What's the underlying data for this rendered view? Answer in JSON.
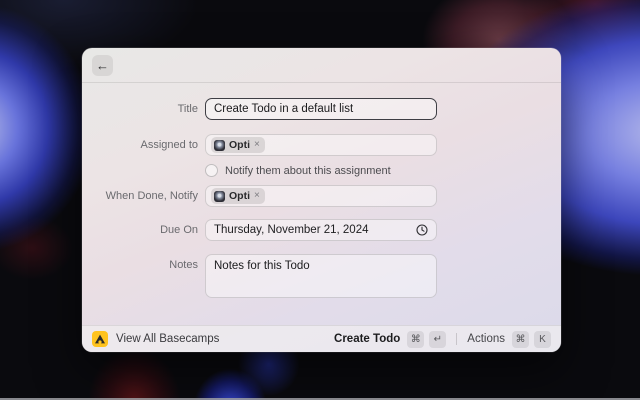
{
  "window": {
    "back_glyph": "←"
  },
  "form": {
    "title": {
      "label": "Title",
      "value": "Create Todo in a default list"
    },
    "assigned_to": {
      "label": "Assigned to",
      "chip": {
        "label": "Opti",
        "remove": "×"
      }
    },
    "notify_checkbox": {
      "label": "Notify them about this assignment",
      "checked": false
    },
    "when_done_notify": {
      "label": "When Done, Notify",
      "chip": {
        "label": "Opti",
        "remove": "×"
      }
    },
    "due_on": {
      "label": "Due On",
      "value": "Thursday, November 21, 2024"
    },
    "notes": {
      "label": "Notes",
      "value": "Notes for this Todo"
    }
  },
  "footer": {
    "view_all_basecamps": "View All Basecamps",
    "create_todo": {
      "label": "Create Todo",
      "keys": [
        "⌘",
        "↵"
      ]
    },
    "actions": {
      "label": "Actions",
      "keys": [
        "⌘",
        "K"
      ]
    }
  },
  "colors": {
    "basecamp_yellow": "#FFC31E",
    "focus_border": "#3E3E44",
    "panel_tint_top": "#E8E8E6",
    "panel_tint_bottom": "#DBDAEA"
  }
}
